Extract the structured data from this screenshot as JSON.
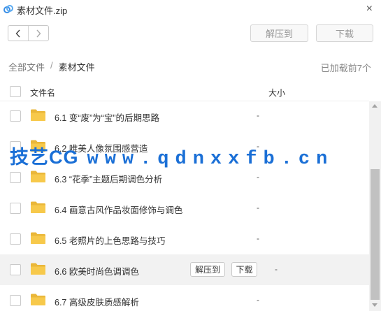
{
  "window": {
    "title": "素材文件.zip",
    "close_icon": "×"
  },
  "toolbar": {
    "extract_label": "解压到",
    "download_label": "下载"
  },
  "breadcrumb": {
    "root": "全部文件",
    "separator": "/",
    "current": "素材文件"
  },
  "status": {
    "loaded": "已加载前7个"
  },
  "columns": {
    "name": "文件名",
    "size": "大小"
  },
  "files": [
    {
      "name": "6.1 变“废”为“宝”的后期思路",
      "size": "-"
    },
    {
      "name": "6.2 唯美人像氛围感营造",
      "size": "-"
    },
    {
      "name": "6.3 “花季”主题后期调色分析",
      "size": "-"
    },
    {
      "name": "6.4 画意古风作品妆面修饰与调色",
      "size": "-"
    },
    {
      "name": "6.5 老照片的上色思路与技巧",
      "size": "-"
    },
    {
      "name": "6.6 欧美时尚色调调色",
      "size": "-",
      "hovered": true,
      "row_extract": "解压到",
      "row_download": "下载"
    },
    {
      "name": "6.7 高级皮肤质感解析",
      "size": "-"
    }
  ],
  "watermark": {
    "brand": "技艺CG",
    "url": "www.qdnxxfb.cn",
    "color": "#1a6fd6"
  },
  "colors": {
    "folder": "#f7c94b",
    "folder_dark": "#eab739",
    "app_icon": "#3a8ee6"
  }
}
